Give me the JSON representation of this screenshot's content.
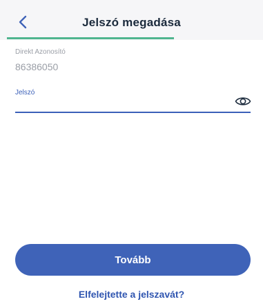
{
  "header": {
    "title": "Jelszó megadása",
    "back_icon": "chevron-left-icon",
    "progress": 0.67
  },
  "form": {
    "id_label": "Direkt Azonosító",
    "id_value": "86386050",
    "password_label": "Jelszó",
    "password_value": "",
    "visibility_icon": "eye-icon"
  },
  "actions": {
    "continue_label": "Tovább",
    "forgot_label": "Elfelejtette a jelszavát?"
  },
  "colors": {
    "accent": "#3f63b8",
    "progress": "#4fb58f",
    "muted_text": "#9a9ea6"
  }
}
